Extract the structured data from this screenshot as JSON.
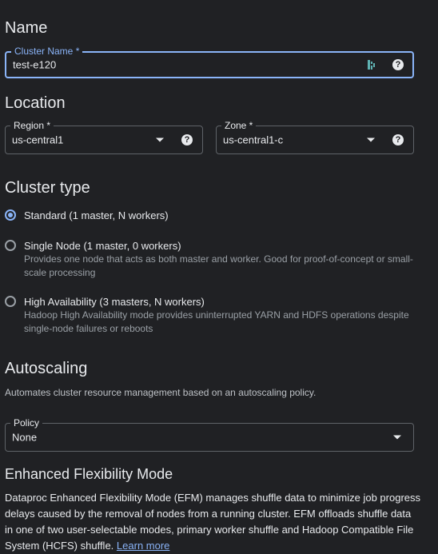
{
  "name_section": {
    "title": "Name",
    "cluster_name": {
      "label": "Cluster Name *",
      "value": "test-e120",
      "help_icon": "help-circle-icon",
      "extension_icon": "password-manager-icon"
    }
  },
  "location_section": {
    "title": "Location",
    "region": {
      "label": "Region *",
      "value": "us-central1"
    },
    "zone": {
      "label": "Zone *",
      "value": "us-central1-c"
    }
  },
  "cluster_type_section": {
    "title": "Cluster type",
    "options": [
      {
        "label": "Standard (1 master, N workers)",
        "description": "",
        "selected": true
      },
      {
        "label": "Single Node (1 master, 0 workers)",
        "description": "Provides one node that acts as both master and worker. Good for proof-of-concept or small-scale processing",
        "selected": false
      },
      {
        "label": "High Availability (3 masters, N workers)",
        "description": "Hadoop High Availability mode provides uninterrupted YARN and HDFS operations despite single-node failures or reboots",
        "selected": false
      }
    ]
  },
  "autoscaling_section": {
    "title": "Autoscaling",
    "description": "Automates cluster resource management based on an autoscaling policy.",
    "policy": {
      "label": "Policy",
      "value": "None"
    }
  },
  "efm_section": {
    "title": "Enhanced Flexibility Mode",
    "description": "Dataproc Enhanced Flexibility Mode (EFM) manages shuffle data to minimize job progress delays caused by the removal of nodes from a running cluster. EFM offloads shuffle data in one of two user-selectable modes, primary worker shuffle and Hadoop Compatible File System (HCFS) shuffle.",
    "learn_more": "Learn more"
  },
  "colors": {
    "background": "#202124",
    "accent": "#8ab4f8",
    "border": "#5f6368",
    "text": "#e8eaed",
    "muted_text": "#9aa0a6"
  }
}
